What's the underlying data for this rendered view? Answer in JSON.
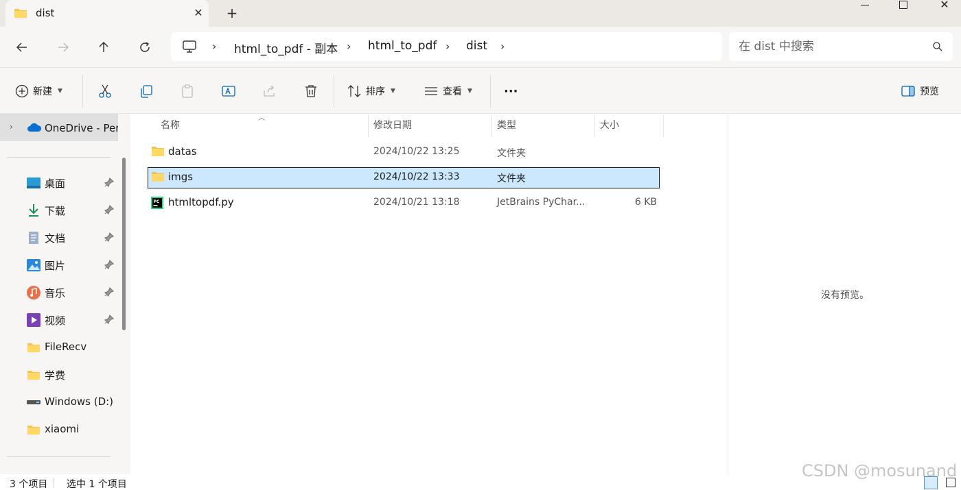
{
  "window": {
    "tab_title": "dist",
    "tab_close": "✕",
    "new_tab": "+"
  },
  "address": {
    "crumbs": [
      "html_to_pdf - 副本",
      "html_to_pdf",
      "dist"
    ],
    "separator": "›"
  },
  "search": {
    "placeholder": "在 dist 中搜索"
  },
  "toolbar": {
    "new_label": "新建",
    "sort_label": "排序",
    "view_label": "查看",
    "more_label": "···",
    "preview_label": "预览"
  },
  "sidebar": {
    "onedrive_label": "OneDrive - Per",
    "items": [
      {
        "label": "桌面",
        "icon": "desktop-icon",
        "pinned": true
      },
      {
        "label": "下载",
        "icon": "download-icon",
        "pinned": true
      },
      {
        "label": "文档",
        "icon": "document-icon",
        "pinned": true
      },
      {
        "label": "图片",
        "icon": "pictures-icon",
        "pinned": true
      },
      {
        "label": "音乐",
        "icon": "music-icon",
        "pinned": true
      },
      {
        "label": "视频",
        "icon": "video-icon",
        "pinned": true
      },
      {
        "label": "FileRecv",
        "icon": "folder-icon",
        "pinned": false
      },
      {
        "label": "学费",
        "icon": "folder-icon",
        "pinned": false
      },
      {
        "label": "Windows (D:)",
        "icon": "drive-icon",
        "pinned": false
      },
      {
        "label": "xiaomi",
        "icon": "folder-icon",
        "pinned": false
      }
    ]
  },
  "columns": {
    "name": "名称",
    "date": "修改日期",
    "type": "类型",
    "size": "大小"
  },
  "files": [
    {
      "name": "datas",
      "date": "2024/10/22 13:25",
      "type": "文件夹",
      "size": "",
      "icon": "folder-icon",
      "selected": false
    },
    {
      "name": "imgs",
      "date": "2024/10/22 13:33",
      "type": "文件夹",
      "size": "",
      "icon": "folder-icon",
      "selected": true
    },
    {
      "name": "htmltopdf.py",
      "date": "2024/10/21 13:18",
      "type": "JetBrains PyChar...",
      "size": "6 KB",
      "icon": "pycharm-file-icon",
      "selected": false
    }
  ],
  "preview": {
    "message": "没有预览。"
  },
  "status": {
    "item_count": "3 个项目",
    "selected_count": "选中 1 个项目"
  },
  "watermark": "CSDN @mosunand",
  "colors": {
    "selection": "#cce8ff",
    "chrome": "#f7f6f4",
    "accent": "#0067c0"
  }
}
